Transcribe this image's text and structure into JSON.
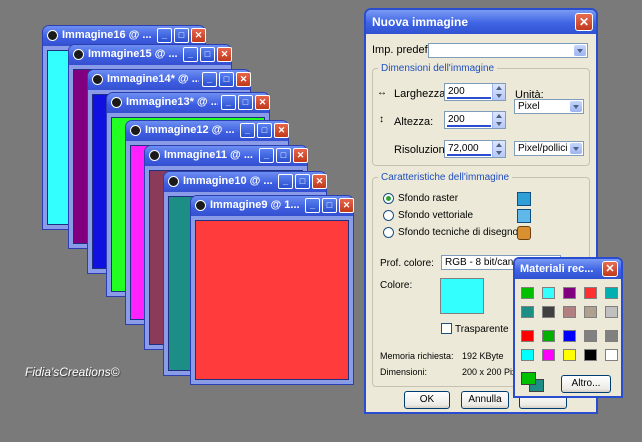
{
  "windows": [
    {
      "title": "Immagine16 @ ...",
      "color": "#33ffff"
    },
    {
      "title": "Immagine15 @ ...",
      "color": "#800080"
    },
    {
      "title": "Immagine14* @ ...",
      "color": "#1010e0"
    },
    {
      "title": "Immagine13* @ ...",
      "color": "#22ff22"
    },
    {
      "title": "Immagine12 @ ...",
      "color": "#ff22ff"
    },
    {
      "title": "Immagine11 @ ...",
      "color": "#8a3b5a"
    },
    {
      "title": "Immagine10 @ ...",
      "color": "#1c8e86"
    },
    {
      "title": "Immagine9 @ 1...",
      "color": "#ff3b3b"
    }
  ],
  "dialog": {
    "title": "Nuova immagine",
    "preset_label": "Imp. predef.:",
    "preset_value": "",
    "dimensions_group": "Dimensioni dell'immagine",
    "width_label": "Larghezza:",
    "width_value": "200",
    "height_label": "Altezza:",
    "height_value": "200",
    "resolution_label": "Risoluzione:",
    "resolution_value": "72,000",
    "units_label": "Unità:",
    "units_value": "Pixel",
    "res_units_value": "Pixel/pollici",
    "features_group": "Caratteristiche dell'immagine",
    "radio_raster": "Sfondo raster",
    "radio_vector": "Sfondo vettoriale",
    "radio_art": "Sfondo tecniche di disegno",
    "depth_label": "Prof. colore:",
    "depth_value": "RGB - 8 bit/canale",
    "color_label": "Colore:",
    "color_value": "#33ffff",
    "transparent_label": "Trasparente",
    "memory_label": "Memoria richiesta:",
    "memory_value": "192 KByte",
    "dims_label": "Dimensioni:",
    "dims_value": "200 x 200 Pixe",
    "ok": "OK",
    "cancel": "Annulla"
  },
  "materials": {
    "title": "Materiali rec...",
    "other_button": "Altro...",
    "swatches_row1": [
      "#00c000",
      "#33ffff",
      "#800080",
      "#ff3030",
      "#00b0b0"
    ],
    "swatches_row2": [
      "#1c8e86",
      "#404040",
      "#b08080",
      "#b0a090",
      "#c0c0c0"
    ],
    "swatches_row3": [
      "#ff0000",
      "#00b000",
      "#0000ff",
      "#808080",
      "#808080"
    ],
    "swatches_row4": [
      "#00ffff",
      "#ff00ff",
      "#ffff00",
      "#000000",
      "#ffffff"
    ],
    "fg_color": "#00c000",
    "bg_color": "#1c8e86"
  },
  "watermark": "Fidia'sCreations©"
}
